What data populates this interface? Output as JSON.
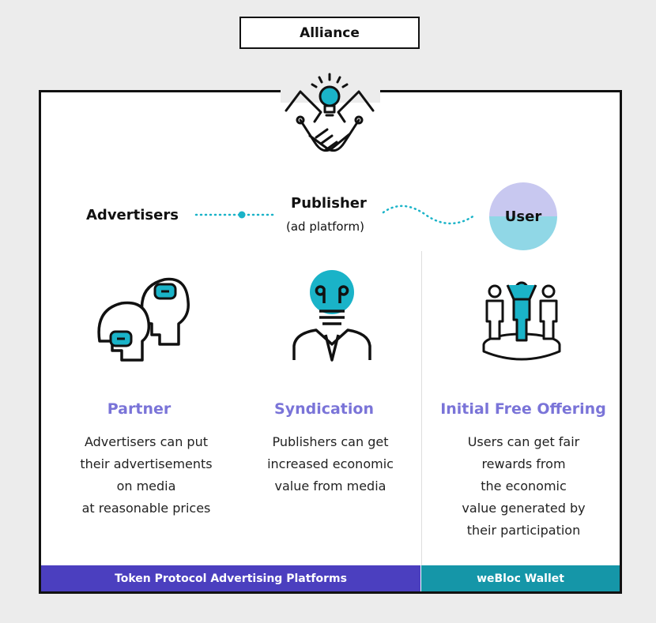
{
  "title": "Alliance",
  "nodes": {
    "advertisers": "Advertisers",
    "publisher": "Publisher",
    "publisher_sub": "(ad platform)",
    "user": "User"
  },
  "columns": [
    {
      "heading": "Partner",
      "lines": [
        "Advertisers can put",
        "their advertisements",
        "on media",
        "at reasonable prices"
      ]
    },
    {
      "heading": "Syndication",
      "lines": [
        "Publishers can get",
        "increased economic",
        "value from media"
      ]
    },
    {
      "heading": "Initial Free Offering",
      "lines": [
        "Users can get fair",
        "rewards from",
        "the economic",
        "value generated by",
        "their participation"
      ]
    }
  ],
  "footer": {
    "left": "Token Protocol Advertising Platforms",
    "right": "weBloc Wallet"
  },
  "colors": {
    "accent_teal": "#1ab3c8",
    "heading_purple": "#7a74d8",
    "footer_left": "#4b3fbf",
    "footer_right": "#1596a8"
  },
  "icons": [
    "handshake-lightbulb-icon",
    "advertisers-heads-icon",
    "publisher-lightbulb-icon",
    "users-podium-icon"
  ]
}
